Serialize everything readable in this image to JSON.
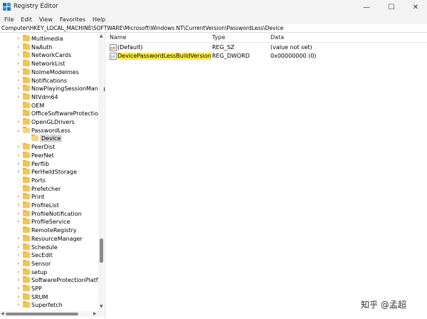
{
  "window": {
    "title": "Registry Editor",
    "controls": {
      "minimize": "—",
      "maximize": "☐",
      "close": "✕"
    }
  },
  "menu": [
    "File",
    "Edit",
    "View",
    "Favorites",
    "Help"
  ],
  "address": "Computer\\HKEY_LOCAL_MACHINE\\SOFTWARE\\Microsoft\\Windows NT\\CurrentVersion\\PasswordLess\\Device",
  "tree": [
    {
      "label": "Multimedia",
      "expander": "›",
      "level": 0
    },
    {
      "label": "NaAuth",
      "expander": "›",
      "level": 0
    },
    {
      "label": "NetworkCards",
      "expander": "›",
      "level": 0
    },
    {
      "label": "NetworkList",
      "expander": "›",
      "level": 0
    },
    {
      "label": "NoImeModelmes",
      "expander": "›",
      "level": 0
    },
    {
      "label": "Notifications",
      "expander": "›",
      "level": 0
    },
    {
      "label": "NowPlayingSessionManag",
      "expander": "›",
      "level": 0
    },
    {
      "label": "NtVdm64",
      "expander": "›",
      "level": 0
    },
    {
      "label": "OEM",
      "expander": "",
      "level": 0
    },
    {
      "label": "OfficeSoftwareProtectionI",
      "expander": "",
      "level": 0
    },
    {
      "label": "OpenGLDrivers",
      "expander": "›",
      "level": 0
    },
    {
      "label": "PasswordLess",
      "expander": "⌄",
      "level": 0,
      "open": true
    },
    {
      "label": "Device",
      "expander": "",
      "level": 1,
      "selected": true,
      "open": true
    },
    {
      "label": "PeerDist",
      "expander": "›",
      "level": 0
    },
    {
      "label": "PeerNet",
      "expander": "›",
      "level": 0
    },
    {
      "label": "Perflib",
      "expander": "›",
      "level": 0
    },
    {
      "label": "PerHwIdStorage",
      "expander": "›",
      "level": 0
    },
    {
      "label": "Ports",
      "expander": "",
      "level": 0
    },
    {
      "label": "Prefetcher",
      "expander": "",
      "level": 0
    },
    {
      "label": "Print",
      "expander": "›",
      "level": 0
    },
    {
      "label": "ProfileList",
      "expander": "›",
      "level": 0
    },
    {
      "label": "ProfileNotification",
      "expander": "›",
      "level": 0
    },
    {
      "label": "ProfileService",
      "expander": "›",
      "level": 0
    },
    {
      "label": "RemoteRegistry",
      "expander": "",
      "level": 0
    },
    {
      "label": "ResourceManager",
      "expander": "›",
      "level": 0
    },
    {
      "label": "Schedule",
      "expander": "›",
      "level": 0
    },
    {
      "label": "SecEdit",
      "expander": "›",
      "level": 0
    },
    {
      "label": "Sensor",
      "expander": "›",
      "level": 0
    },
    {
      "label": "setup",
      "expander": "›",
      "level": 0
    },
    {
      "label": "SoftwareProtectionPlatfor",
      "expander": "›",
      "level": 0
    },
    {
      "label": "SPP",
      "expander": "›",
      "level": 0
    },
    {
      "label": "SRUM",
      "expander": "›",
      "level": 0
    },
    {
      "label": "Superfetch",
      "expander": "›",
      "level": 0
    }
  ],
  "list": {
    "headers": {
      "name": "Name",
      "type": "Type",
      "data": "Data"
    },
    "rows": [
      {
        "icon": "string-value-icon",
        "name": "(Default)",
        "type": "REG_SZ",
        "data": "(value not set)",
        "highlight": false
      },
      {
        "icon": "dword-value-icon",
        "name": "DevicePasswordLessBuildVersion",
        "type": "REG_DWORD",
        "data": "0x00000000 (0)",
        "highlight": true
      }
    ]
  },
  "scrollbar_arrows": {
    "up": "▲",
    "down": "▼",
    "left": "◀",
    "right": "▶"
  },
  "watermark": "知乎 @孟超",
  "colors": {
    "highlight": "#ffef3a",
    "folder": "#f6c453",
    "titlebar": "#f3f3f3"
  }
}
